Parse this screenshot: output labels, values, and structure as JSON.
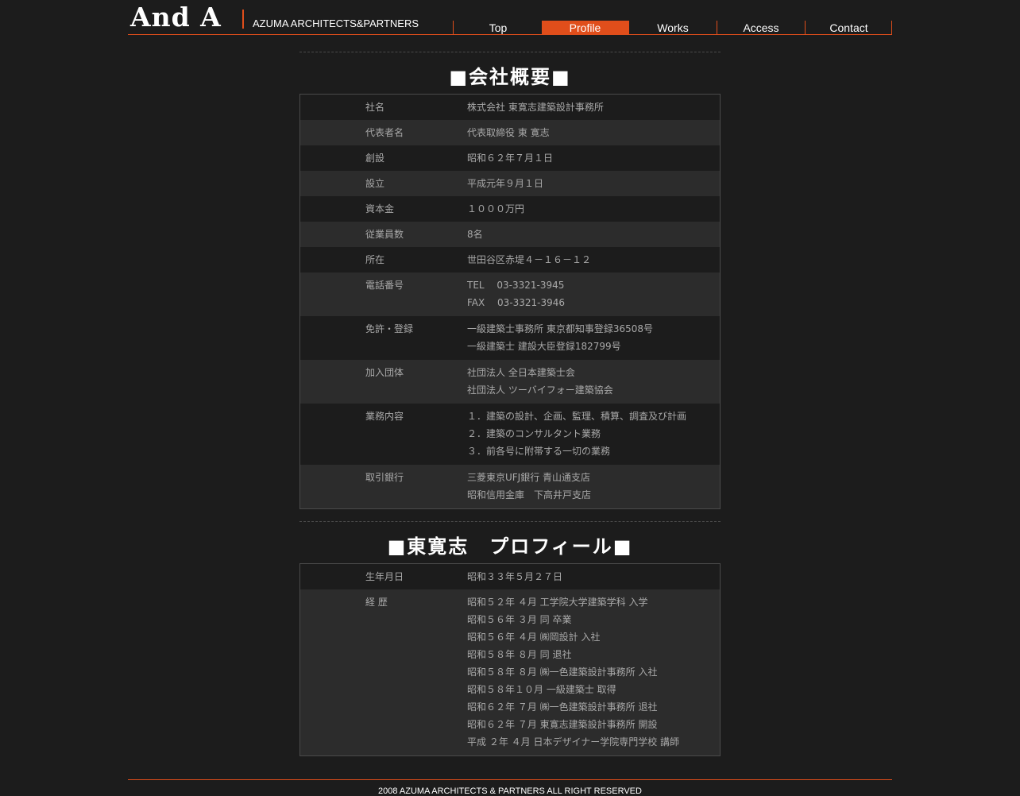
{
  "header": {
    "logo": "And A",
    "tagline": "AZUMA ARCHITECTS&PARTNERS"
  },
  "nav": {
    "items": [
      {
        "label": "Top"
      },
      {
        "label": "Profile"
      },
      {
        "label": "Works"
      },
      {
        "label": "Access"
      },
      {
        "label": "Contact"
      }
    ],
    "active": "Profile"
  },
  "company": {
    "title": "■会社概要■",
    "rows": [
      {
        "label": "社名",
        "values": [
          "株式会社 東寛志建築設計事務所"
        ]
      },
      {
        "label": "代表者名",
        "values": [
          "代表取締役 東 寛志"
        ]
      },
      {
        "label": "創設",
        "values": [
          "昭和６２年７月１日"
        ]
      },
      {
        "label": "設立",
        "values": [
          "平成元年９月１日"
        ]
      },
      {
        "label": "資本金",
        "values": [
          "１０００万円"
        ]
      },
      {
        "label": "従業員数",
        "values": [
          "8名"
        ]
      },
      {
        "label": "所在",
        "values": [
          "世田谷区赤堤４－１６－１２"
        ]
      },
      {
        "label": "電話番号",
        "values": [
          "TEL　 03-3321-3945",
          "FAX　 03-3321-3946"
        ]
      },
      {
        "label": "免許・登録",
        "values": [
          "一級建築士事務所 東京都知事登録36508号",
          "一級建築士 建設大臣登録182799号"
        ]
      },
      {
        "label": "加入団体",
        "values": [
          "社団法人 全日本建築士会",
          "社団法人 ツーバイフォー建築協会"
        ]
      },
      {
        "label": "業務内容",
        "values": [
          "１．建築の設計、企画、監理、積算、調査及び計画",
          "２．建築のコンサルタント業務",
          "３．前各号に附帯する一切の業務"
        ]
      },
      {
        "label": "取引銀行",
        "values": [
          "三菱東京UFJ銀行 青山通支店",
          "昭和信用金庫　下高井戸支店"
        ]
      }
    ]
  },
  "profile": {
    "title": "■東寛志　プロフィール■",
    "rows": [
      {
        "label": "生年月日",
        "values": [
          "昭和３３年５月２７日"
        ]
      },
      {
        "label": "経 歴",
        "values": [
          "昭和５２年 ４月 工学院大学建築学科 入学",
          "昭和５６年 ３月 同 卒業",
          "昭和５６年 ４月 ㈱岡設計 入社",
          "昭和５８年 ８月 同 退社",
          "昭和５８年 ８月 ㈱一色建築設計事務所 入社",
          "昭和５８年１０月 一級建築士 取得",
          "昭和６２年 ７月 ㈱一色建築設計事務所 退社",
          "昭和６２年 ７月 東寛志建築設計事務所 開設",
          "平成 ２年 ４月 日本デザイナー学院専門学校 講師"
        ]
      }
    ]
  },
  "footer": {
    "copyright": "2008 AZUMA ARCHITECTS & PARTNERS ALL RIGHT RESERVED"
  },
  "colors": {
    "accent": "#e04e1b",
    "background": "#1c1c1c",
    "row_alt": "#2c2c2c",
    "text": "#a9a9a9"
  }
}
